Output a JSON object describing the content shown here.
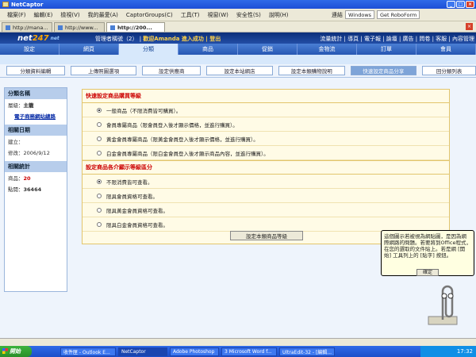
{
  "window": {
    "title": "NetCaptor"
  },
  "menu": {
    "items": [
      "檔案(F)",
      "編輯(E)",
      "檢視(V)",
      "我的最愛(A)",
      "CaptorGroups(C)",
      "工具(T)",
      "視窗(W)",
      "安全性(S)",
      "說明(H)"
    ],
    "address": "http://200..."
  },
  "toolbar": {
    "search_label": "連結",
    "windows_label": "Windows",
    "getroboform": "Get RoboForm"
  },
  "tabs": [
    {
      "label": "http://mana..."
    },
    {
      "label": "http://www..."
    },
    {
      "label": "http://200..."
    }
  ],
  "header": {
    "logo_main": "net",
    "logo_accent": "247",
    "logo_sub": "net",
    "admin_text": "管理者稱號（2）",
    "welcome": "歡迎Amanda 進入成功 | 登出",
    "right_links": "流量統計 | 導頁 | 電子報 | 論壇 | 廣告 | 問卷 | 客服 | 內容管理"
  },
  "nav": [
    "設定",
    "網頁",
    "分類",
    "商品",
    "促銷",
    "金物流",
    "訂單",
    "會員"
  ],
  "subnav": [
    "分類資料編輯",
    "上傳照圖選項",
    "設定供應商",
    "設定本站網店",
    "設定本類購物說明",
    "快速設定商品分享",
    "回分類列表"
  ],
  "sidebar": {
    "section1_title": "分類名稱",
    "level_label": "層級：",
    "level_value": "主籠",
    "link": "電子商務網站總路",
    "section2_title": "相關日期",
    "created_label": "建立：",
    "modified_label": "修改：",
    "modified_value": "2006/9/12",
    "section3_title": "相關統計",
    "items_label": "商品：",
    "items_value": "20",
    "clicks_label": "點閱：",
    "clicks_value": "36464"
  },
  "form": {
    "section1_title": "快速設定商品購買等級",
    "options1": [
      "一般商品（不限消費皆可購買）。",
      "會員專屬商品（限會員登入後才顯示價格，並進行購買）。",
      "黃金會員專屬商品（限黃金會員登入後才顯示價格，並進行購買）。",
      "白金會員專屬商品（限白金會員登入後才顯示商品內容，並進行購買）。"
    ],
    "section2_title": "設定商品各介顯示等級區分",
    "options2": [
      "不限消費皆可查看。",
      "限具會員資格可查看。",
      "限具黃金會員資格可查看。",
      "限具白金會員資格可查看。"
    ],
    "submit_label": "設定本類商品等級"
  },
  "clippy": {
    "text": "這個圖示若被視為網貼圖，是因為網際網路的問題。若要將到Office程式，在您的選取的文件貼上。若是網 [開始] 工具列上的 [貼字] 按鈕。",
    "ok_label": "確定"
  },
  "status": {
    "text": ""
  },
  "taskbar": {
    "start_label": "開始",
    "tasks": [
      "收件匣 - Outlook E...",
      "NetCaptor",
      "Adobe Photoshop",
      "3 Microsoft Word f...",
      "UltraEdit-32 - [編輯..."
    ],
    "clock": "17:32"
  }
}
